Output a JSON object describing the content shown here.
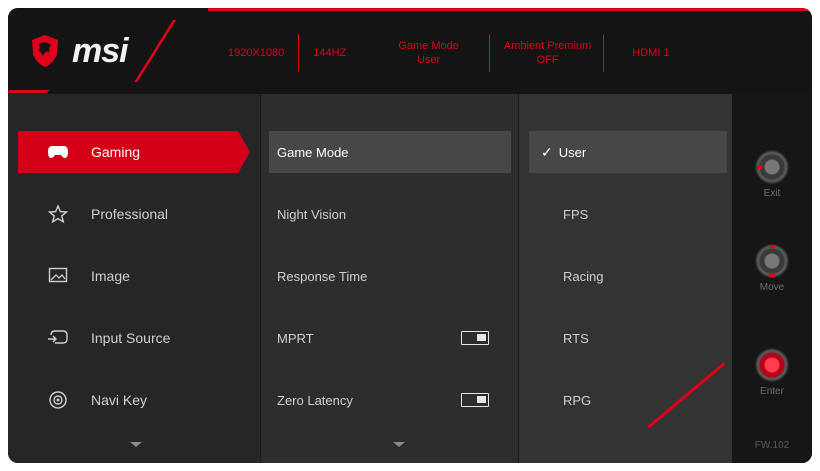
{
  "brand": {
    "logo_text": "msi"
  },
  "status_bar": [
    {
      "text": "1920X1080"
    },
    {
      "text": "144HZ"
    },
    {
      "line1": "Game Mode",
      "line2": "User"
    },
    {
      "line1": "Ambient Premium",
      "line2": "OFF"
    },
    {
      "text": "HDMI 1"
    }
  ],
  "main_menu": [
    {
      "label": "Gaming",
      "icon": "gamepad-icon",
      "active": true
    },
    {
      "label": "Professional",
      "icon": "star-icon"
    },
    {
      "label": "Image",
      "icon": "image-icon"
    },
    {
      "label": "Input Source",
      "icon": "input-source-icon"
    },
    {
      "label": "Navi Key",
      "icon": "navi-key-icon"
    }
  ],
  "sub_menu": [
    {
      "label": "Game Mode",
      "active": true
    },
    {
      "label": "Night Vision"
    },
    {
      "label": "Response Time"
    },
    {
      "label": "MPRT",
      "toggle": "on"
    },
    {
      "label": "Zero Latency",
      "toggle": "on"
    }
  ],
  "options": [
    {
      "label": "User",
      "selected": true
    },
    {
      "label": "FPS"
    },
    {
      "label": "Racing"
    },
    {
      "label": "RTS"
    },
    {
      "label": "RPG"
    }
  ],
  "nav": {
    "exit_label": "Exit",
    "move_label": "Move",
    "enter_label": "Enter",
    "firmware": "FW.102"
  },
  "colors": {
    "accent": "#e1001a",
    "active_bg": "#d40018"
  }
}
